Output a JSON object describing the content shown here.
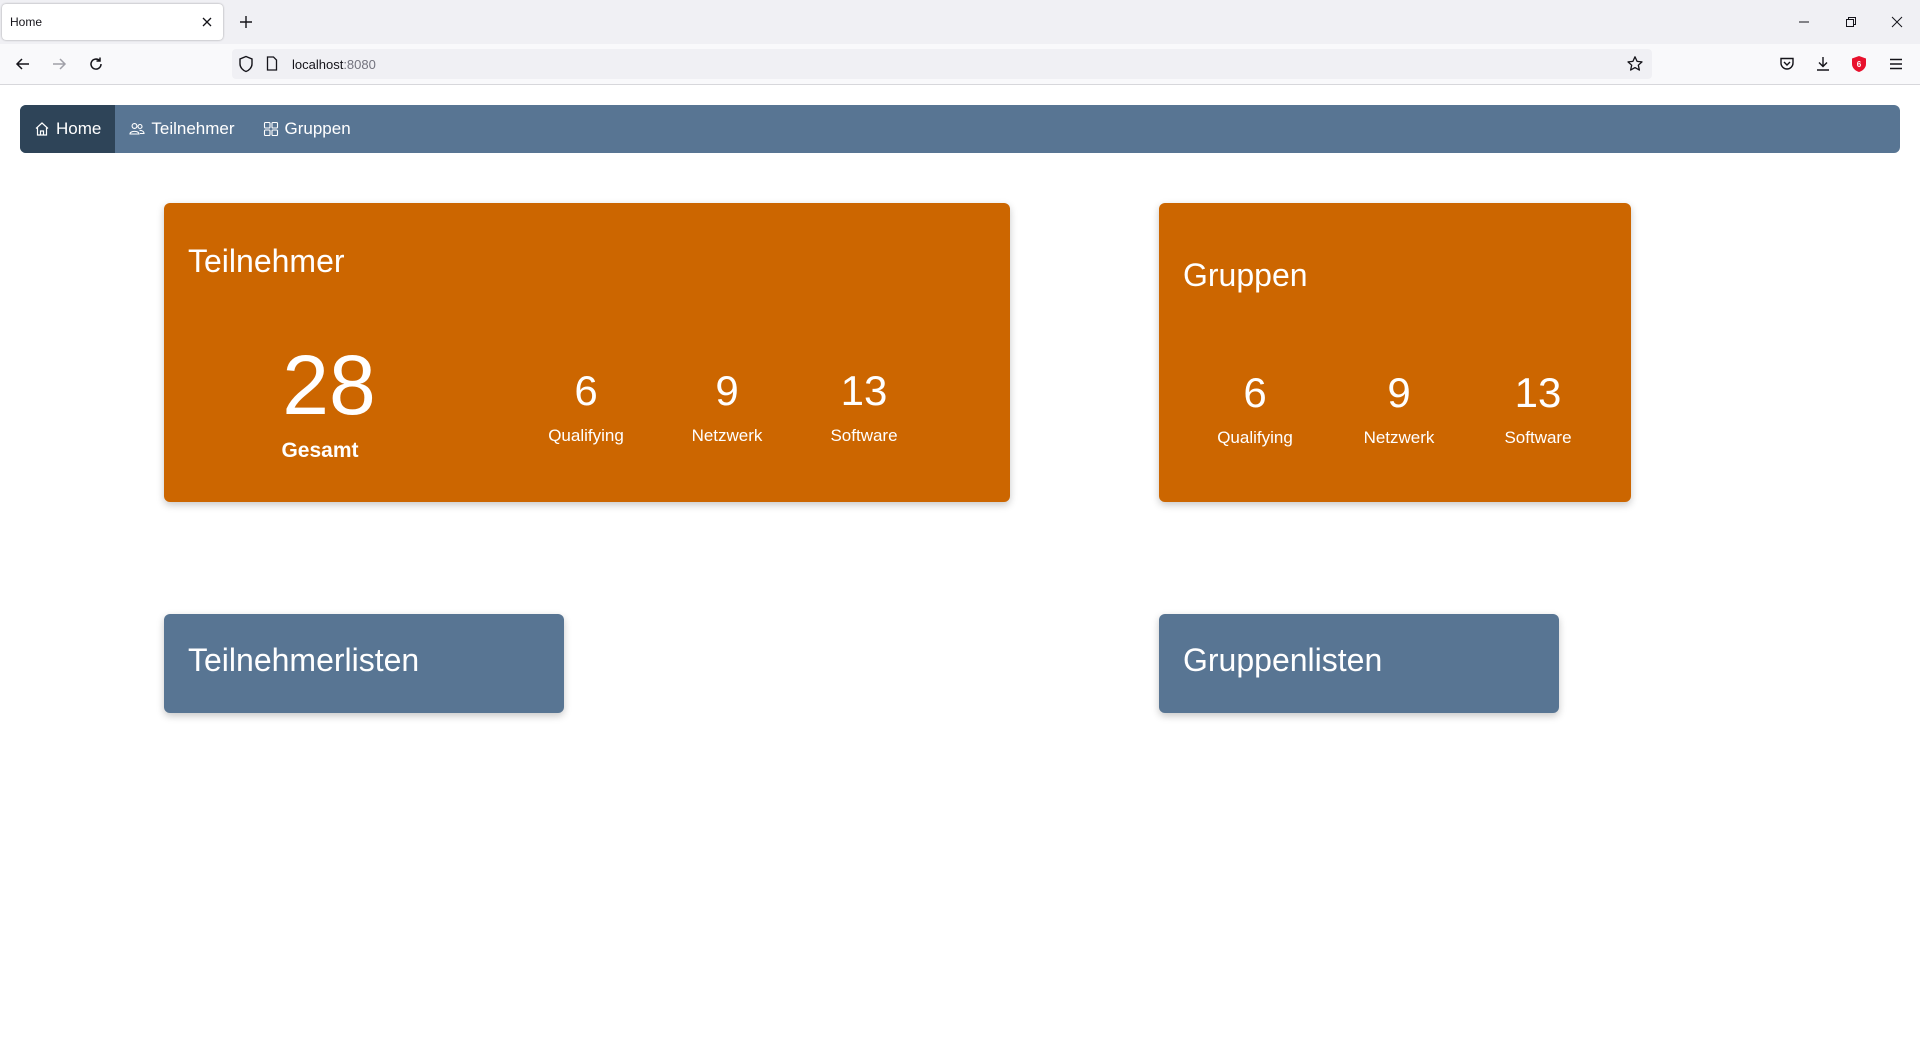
{
  "browser": {
    "tab_title": "Home",
    "url_host": "localhost",
    "url_port": ":8080"
  },
  "nav": {
    "items": [
      {
        "label": "Home",
        "icon": "home-icon",
        "active": true
      },
      {
        "label": "Teilnehmer",
        "icon": "users-icon",
        "active": false
      },
      {
        "label": "Gruppen",
        "icon": "grid-icon",
        "active": false
      }
    ]
  },
  "teilnehmer_card": {
    "title": "Teilnehmer",
    "total_value": "28",
    "total_label": "Gesamt",
    "stats": [
      {
        "value": "6",
        "label": "Qualifying"
      },
      {
        "value": "9",
        "label": "Netzwerk"
      },
      {
        "value": "13",
        "label": "Software"
      }
    ]
  },
  "gruppen_card": {
    "title": "Gruppen",
    "stats": [
      {
        "value": "6",
        "label": "Qualifying"
      },
      {
        "value": "9",
        "label": "Netzwerk"
      },
      {
        "value": "13",
        "label": "Software"
      }
    ]
  },
  "teilnehmerlisten_card": {
    "title": "Teilnehmerlisten"
  },
  "gruppenlisten_card": {
    "title": "Gruppenlisten"
  },
  "colors": {
    "accent_orange": "#cc6600",
    "slate": "#587593",
    "nav_active": "#2e4458"
  }
}
